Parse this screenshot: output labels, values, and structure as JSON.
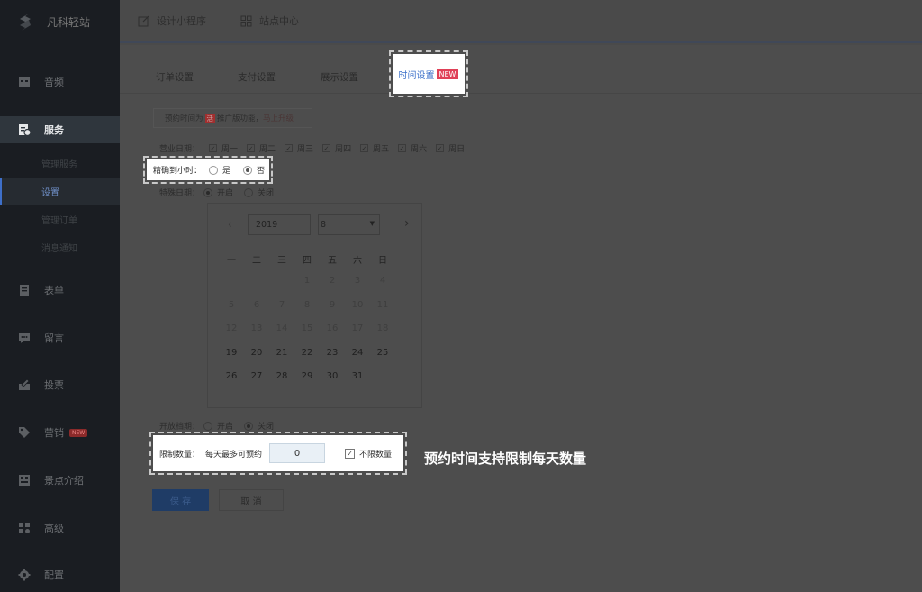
{
  "brand": {
    "name": "凡科轻站"
  },
  "sidebar": {
    "items": [
      {
        "label": "音频"
      },
      {
        "label": "服务"
      },
      {
        "label": "表单"
      },
      {
        "label": "留言"
      },
      {
        "label": "投票"
      },
      {
        "label": "营销",
        "badge": "NEW"
      },
      {
        "label": "景点介绍"
      },
      {
        "label": "高级"
      },
      {
        "label": "配置"
      }
    ],
    "subitems": [
      {
        "label": "管理服务"
      },
      {
        "label": "设置"
      },
      {
        "label": "管理订单"
      },
      {
        "label": "消息通知"
      }
    ]
  },
  "topbar": {
    "design_label": "设计小程序",
    "center_label": "站点中心"
  },
  "tabs": [
    {
      "label": "订单设置"
    },
    {
      "label": "支付设置"
    },
    {
      "label": "展示设置"
    },
    {
      "label": "时间设置",
      "tag": "NEW"
    }
  ],
  "notice": {
    "prefix": "预约时间为",
    "tag": "活",
    "middle": "推广版功能，",
    "link": "马上升级"
  },
  "business_days": {
    "label": "营业日期：",
    "days": [
      "周一",
      "周二",
      "周三",
      "周四",
      "周五",
      "周六",
      "周日"
    ]
  },
  "precise_hour": {
    "label": "精确到小时：",
    "yes": "是",
    "no": "否",
    "selected": "否"
  },
  "special_date": {
    "label": "特殊日期：",
    "on": "开启",
    "off": "关闭",
    "selected": "开启"
  },
  "calendar": {
    "year": "2019",
    "month": "8",
    "prev": "‹",
    "next": "›",
    "weekdays": [
      "一",
      "二",
      "三",
      "四",
      "五",
      "六",
      "日"
    ],
    "weeks": [
      [
        "",
        "",
        "",
        "1",
        "2",
        "3",
        "4"
      ],
      [
        "5",
        "6",
        "7",
        "8",
        "9",
        "10",
        "11"
      ],
      [
        "12",
        "13",
        "14",
        "15",
        "16",
        "17",
        "18"
      ],
      [
        "19",
        "20",
        "21",
        "22",
        "23",
        "24",
        "25"
      ],
      [
        "26",
        "27",
        "28",
        "29",
        "30",
        "31",
        ""
      ]
    ],
    "muted_through": "18"
  },
  "release_period": {
    "label": "开放档期：",
    "on": "开启",
    "off": "关闭",
    "selected": "关闭"
  },
  "limit": {
    "label": "限制数量：",
    "per_day": "每天最多可预约",
    "value": "0",
    "unlimited_label": "不限数量",
    "unlimited_checked": true
  },
  "callout": "预约时间支持限制每天数量",
  "buttons": {
    "save": "保 存",
    "cancel": "取 消"
  }
}
